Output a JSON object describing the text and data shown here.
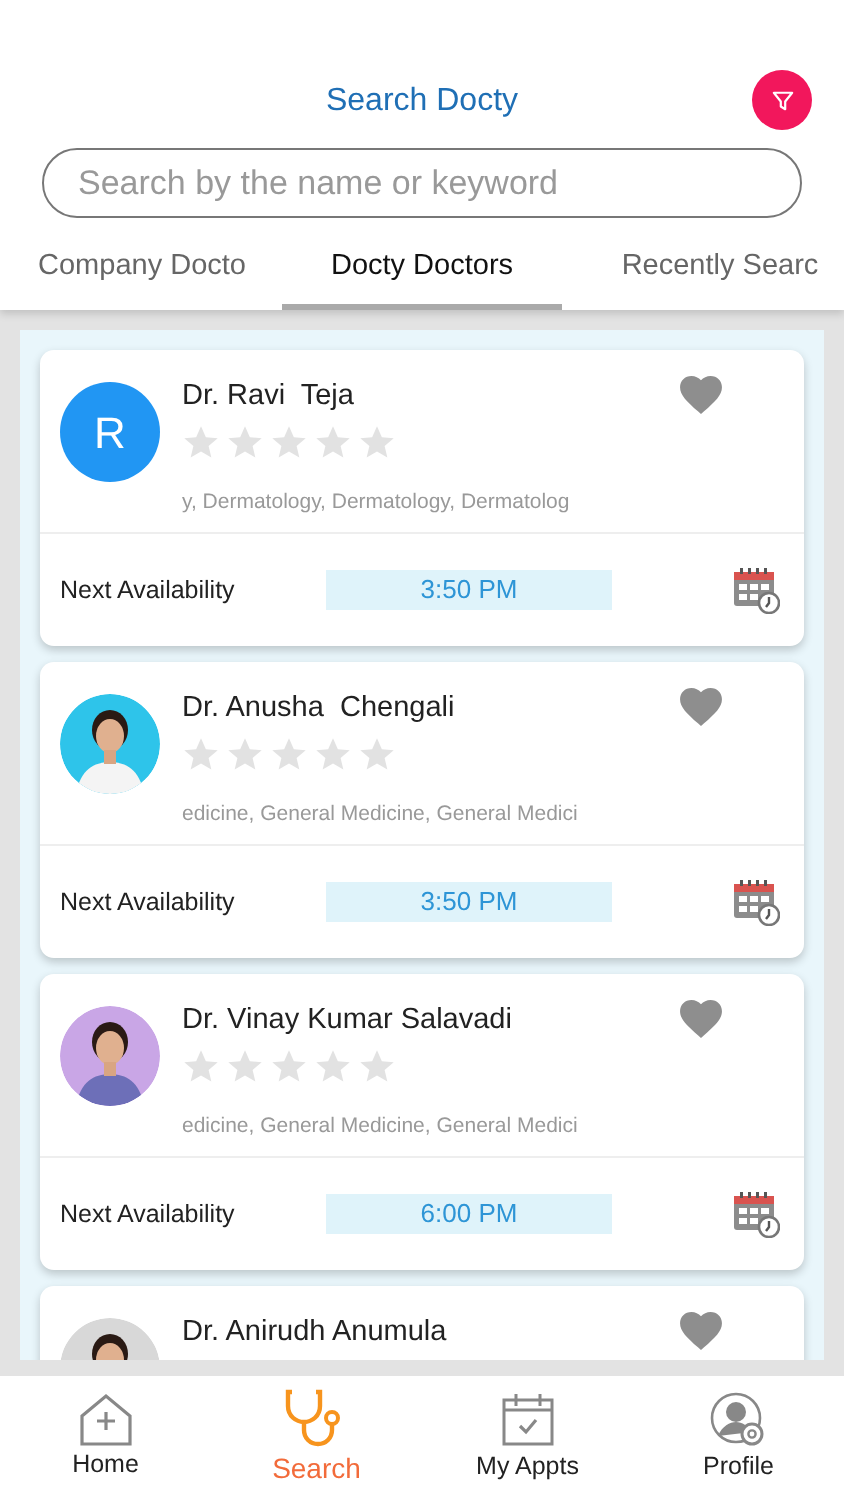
{
  "header": {
    "title": "Search Docty"
  },
  "search": {
    "placeholder": "Search by the name or keyword"
  },
  "tabs": [
    {
      "label": "Company Docto",
      "selected": false
    },
    {
      "label": "Docty Doctors",
      "selected": true
    },
    {
      "label": "Recently Searc",
      "selected": false
    }
  ],
  "doctors": [
    {
      "name": "Dr. Ravi  Teja",
      "avatar": {
        "kind": "initial",
        "text": "R"
      },
      "stars": 0,
      "specialties": "y, Dermatology, Dermatology, Dermatolog",
      "availability_label": "Next Availability",
      "availability": "3:50 PM"
    },
    {
      "name": "Dr. Anusha  Chengali",
      "stars": 0,
      "specialties": "edicine, General Medicine, General Medici",
      "availability_label": "Next Availability",
      "availability": "3:50 PM"
    },
    {
      "name": "Dr. Vinay Kumar Salavadi",
      "stars": 0,
      "specialties": "edicine, General Medicine, General Medici",
      "availability_label": "Next Availability",
      "availability": "6:00 PM"
    },
    {
      "name": "Dr. Anirudh Anumula"
    }
  ],
  "bottom_nav": [
    {
      "label": "Home",
      "selected": false
    },
    {
      "label": "Search",
      "selected": true
    },
    {
      "label": "My Appts",
      "selected": false
    },
    {
      "label": "Profile",
      "selected": false
    }
  ]
}
